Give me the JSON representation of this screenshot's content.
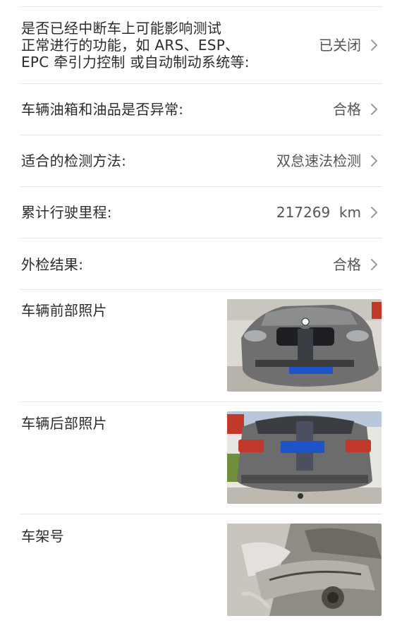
{
  "rows": [
    {
      "label_lines": [
        "是否已经中断车上可能影响测试",
        "正常进行的功能，如 ARS、ESP、",
        "EPC 牵引力控制 或自动制动系统等:"
      ],
      "value": "已关闭",
      "icon": "chevron-right-icon"
    },
    {
      "label": "车辆油箱和油品是否异常:",
      "value": "合格",
      "icon": "chevron-right-icon"
    },
    {
      "label": "适合的检测方法:",
      "value": "双怠速法检测",
      "icon": "chevron-right-icon"
    },
    {
      "label": "累计行驶里程:",
      "value": "217269  km",
      "icon": "chevron-right-icon"
    },
    {
      "label": "外检结果:",
      "value": "合格",
      "icon": "chevron-right-icon"
    }
  ],
  "photos": [
    {
      "label": "车辆前部照片",
      "image": "car-front-photo"
    },
    {
      "label": "车辆后部照片",
      "image": "car-rear-photo"
    },
    {
      "label": "车架号",
      "image": "vin-engine-photo"
    }
  ],
  "colors": {
    "text": "#2c2c2c",
    "value_text": "#555555",
    "divider": "#e6e6e6",
    "chevron": "#9a9a9a",
    "plate_blue": "#1d55c9",
    "car_grey": "#6e6f6e"
  }
}
